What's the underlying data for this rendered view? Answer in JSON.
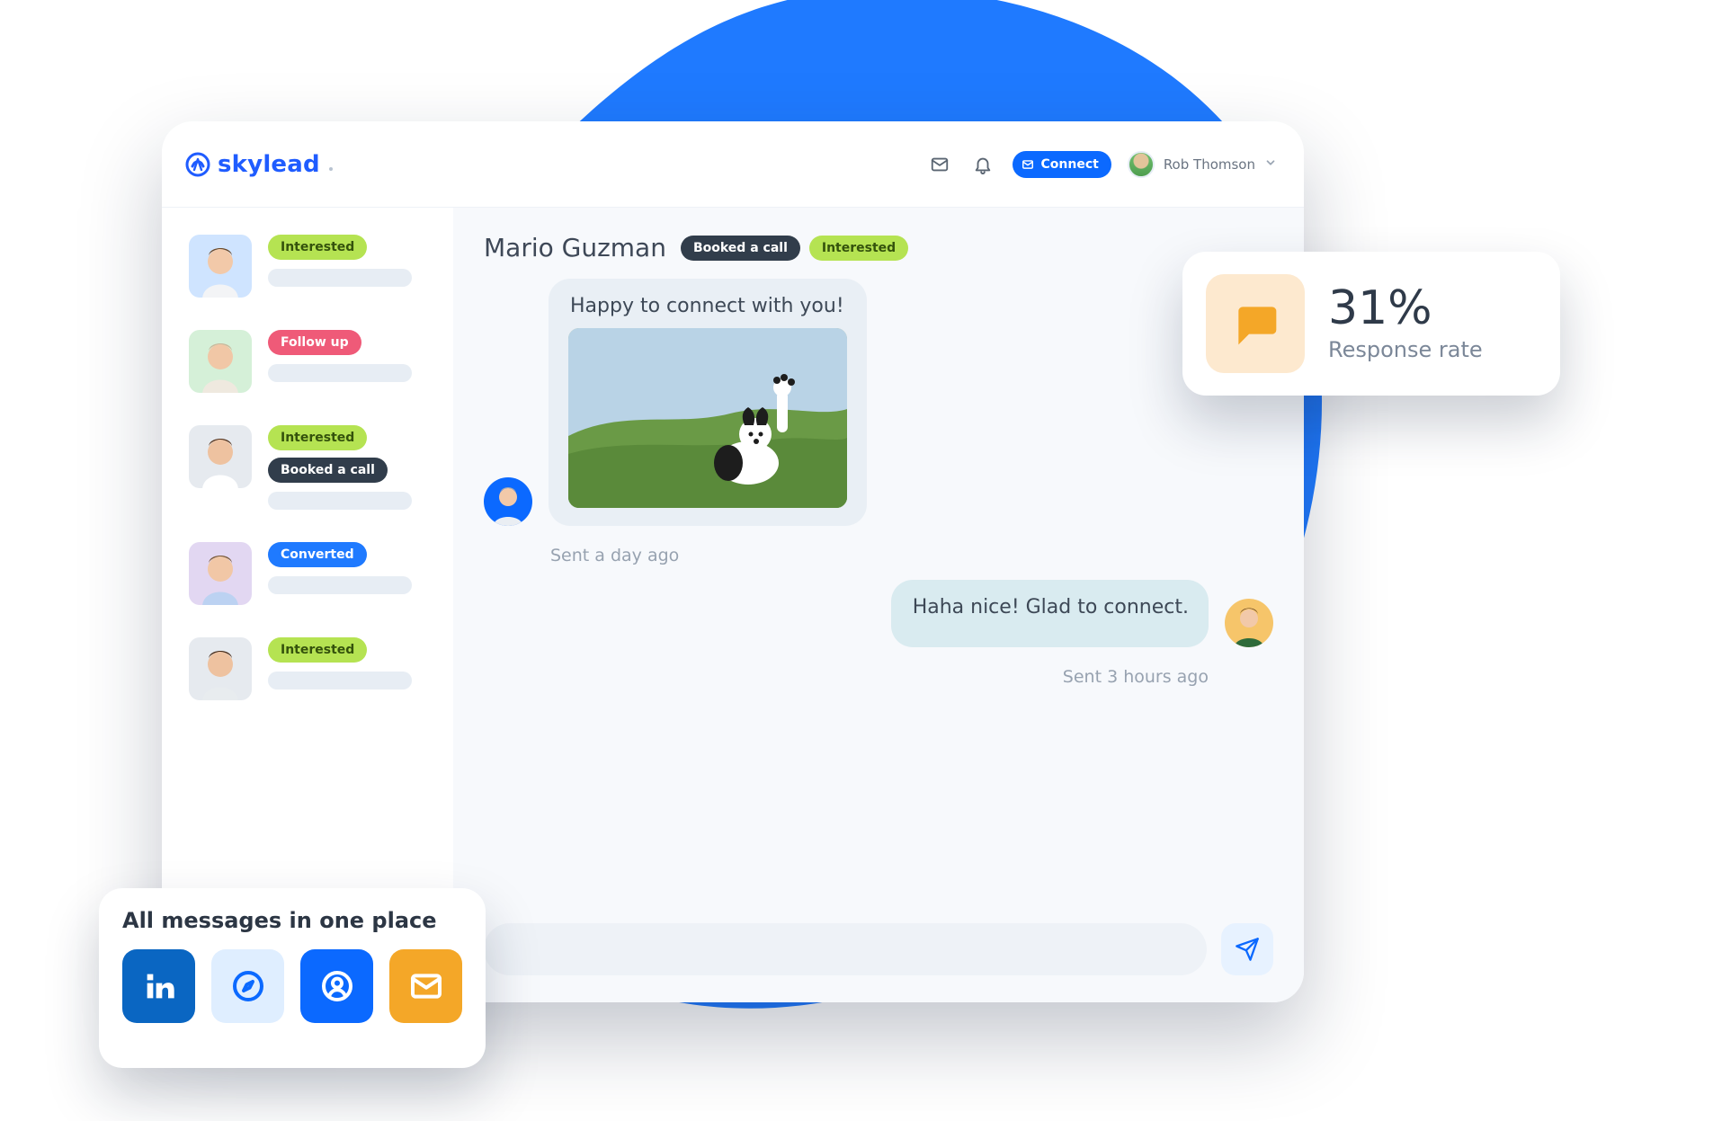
{
  "brand": {
    "name": "skylead"
  },
  "header": {
    "connect_label": "Connect",
    "user_name": "Rob Thomson"
  },
  "sidebar": {
    "items": [
      {
        "tags": [
          {
            "label": "Interested",
            "variant": "green"
          }
        ],
        "photo_tint": "bg-blue"
      },
      {
        "tags": [
          {
            "label": "Follow up",
            "variant": "red"
          }
        ],
        "photo_tint": "bg-green"
      },
      {
        "tags": [
          {
            "label": "Interested",
            "variant": "green"
          },
          {
            "label": "Booked a call",
            "variant": "dark"
          }
        ],
        "photo_tint": "bg-gray"
      },
      {
        "tags": [
          {
            "label": "Converted",
            "variant": "blue"
          }
        ],
        "photo_tint": "bg-purple"
      },
      {
        "tags": [
          {
            "label": "Interested",
            "variant": "green"
          }
        ],
        "photo_tint": "bg-gray"
      }
    ]
  },
  "chat": {
    "name": "Mario Guzman",
    "tags": [
      {
        "label": "Booked a call",
        "variant": "dark"
      },
      {
        "label": "Interested",
        "variant": "green"
      }
    ],
    "messages": [
      {
        "side": "left",
        "text": "Happy to connect with you!",
        "has_media": true,
        "meta": "Sent a day ago"
      },
      {
        "side": "right",
        "text": "Haha nice! Glad to connect.",
        "has_media": false,
        "meta": "Sent 3 hours ago"
      }
    ],
    "composer_placeholder": ""
  },
  "stat_card": {
    "value": "31%",
    "label": "Response rate"
  },
  "channels_card": {
    "title": "All messages in one place",
    "items": [
      {
        "name": "linkedin-icon"
      },
      {
        "name": "compass-icon"
      },
      {
        "name": "person-search-icon"
      },
      {
        "name": "mail-icon"
      }
    ]
  },
  "icons": {
    "mail": "mail-icon",
    "bell": "bell-icon",
    "chevron": "chevron-down-icon",
    "send": "send-icon",
    "chat": "chat-bubble-icon"
  }
}
